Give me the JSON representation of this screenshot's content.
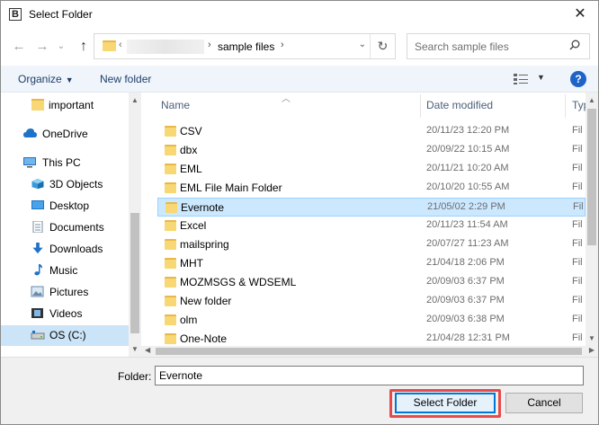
{
  "window": {
    "title": "Select Folder",
    "app_icon_letter": "B",
    "close_glyph": "✕"
  },
  "address": {
    "crumb": "sample files",
    "search_placeholder": "Search sample files"
  },
  "toolbar": {
    "organize_label": "Organize",
    "new_folder_label": "New folder",
    "help_label": "?"
  },
  "nav": {
    "items": [
      {
        "label": "important",
        "icon": "folder-icon"
      },
      {
        "label": "OneDrive",
        "icon": "cloud-icon"
      },
      {
        "label": "This PC",
        "icon": "computer-icon"
      },
      {
        "label": "3D Objects",
        "icon": "cube-icon"
      },
      {
        "label": "Desktop",
        "icon": "desktop-icon"
      },
      {
        "label": "Documents",
        "icon": "documents-icon"
      },
      {
        "label": "Downloads",
        "icon": "download-icon"
      },
      {
        "label": "Music",
        "icon": "music-icon"
      },
      {
        "label": "Pictures",
        "icon": "pictures-icon"
      },
      {
        "label": "Videos",
        "icon": "videos-icon"
      },
      {
        "label": "OS (C:)",
        "icon": "drive-icon",
        "selected": true
      }
    ]
  },
  "files": {
    "columns": [
      "Name",
      "Date modified",
      "Typ"
    ],
    "rows": [
      {
        "name": "CSV",
        "date": "20/11/23 12:20 PM",
        "type": "Fil"
      },
      {
        "name": "dbx",
        "date": "20/09/22 10:15 AM",
        "type": "Fil"
      },
      {
        "name": "EML",
        "date": "20/11/21 10:20 AM",
        "type": "Fil"
      },
      {
        "name": "EML File Main Folder",
        "date": "20/10/20 10:55 AM",
        "type": "Fil"
      },
      {
        "name": "Evernote",
        "date": "21/05/02 2:29 PM",
        "type": "Fil",
        "selected": true
      },
      {
        "name": "Excel",
        "date": "20/11/23 11:54 AM",
        "type": "Fil"
      },
      {
        "name": "mailspring",
        "date": "20/07/27 11:23 AM",
        "type": "Fil"
      },
      {
        "name": "MHT",
        "date": "21/04/18 2:06 PM",
        "type": "Fil"
      },
      {
        "name": "MOZMSGS & WDSEML",
        "date": "20/09/03 6:37 PM",
        "type": "Fil"
      },
      {
        "name": "New folder",
        "date": "20/09/03 6:37 PM",
        "type": "Fil"
      },
      {
        "name": "olm",
        "date": "20/09/03 6:38 PM",
        "type": "Fil"
      },
      {
        "name": "One-Note",
        "date": "21/04/28 12:31 PM",
        "type": "Fil"
      }
    ]
  },
  "footer": {
    "folder_label": "Folder:",
    "folder_value": "Evernote",
    "select_label": "Select Folder",
    "cancel_label": "Cancel"
  },
  "colors": {
    "accent": "#0078d7",
    "selection": "#cce8ff",
    "highlight": "#e64b4b",
    "folder": "#f8d775"
  }
}
